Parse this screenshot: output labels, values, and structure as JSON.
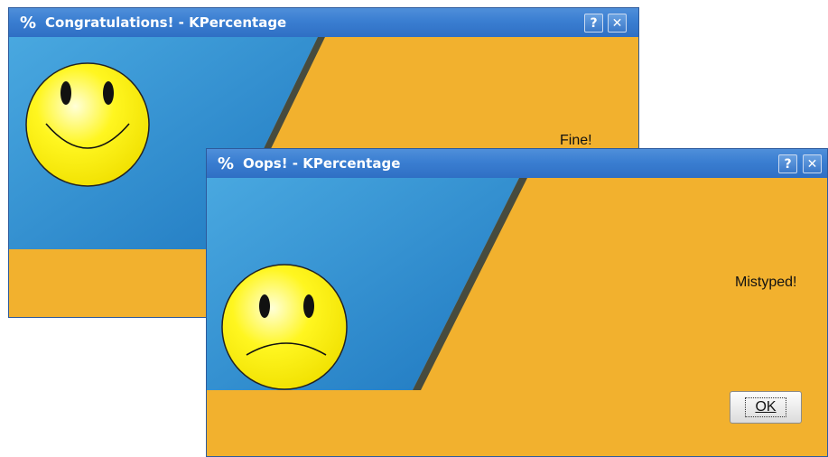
{
  "windows": {
    "congrats": {
      "title": "Congratulations! - KPercentage",
      "app_icon": "%",
      "help_button": "?",
      "close_button": "✕",
      "message": "Fine!"
    },
    "oops": {
      "title": "Oops! - KPercentage",
      "app_icon": "%",
      "help_button": "?",
      "close_button": "✕",
      "message": "Mistyped!",
      "ok_button": "OK"
    }
  },
  "colors": {
    "blue_panel": "#2e8fd0",
    "orange_panel": "#f2b12e",
    "titlebar": "#3a7ed1",
    "smiley_face": "#fff620"
  },
  "icons": {
    "congrats_face": "happy-face-icon",
    "oops_face": "sad-face-icon"
  }
}
